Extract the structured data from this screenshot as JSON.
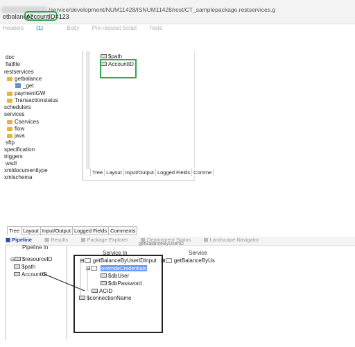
{
  "url_bar": {
    "path": "/service/development/NUM11428/ISNUM11428/rest/CT_samplepackage.restservices.g",
    "request_prefix": "etbalance?",
    "query_param": "AccountID=123"
  },
  "request_tabs": [
    {
      "label": "Headers",
      "count": "(1)"
    },
    {
      "label": "Body"
    },
    {
      "label": "Pre-request Script"
    },
    {
      "label": "Tests"
    }
  ],
  "navigator": {
    "items": [
      {
        "label": "doc",
        "icon": "none"
      },
      {
        "label": "flatfile",
        "icon": "none"
      },
      {
        "label": "restservices",
        "icon": "none"
      },
      {
        "label": "getbalance",
        "icon": "folder-icon"
      },
      {
        "label": "_get",
        "icon": "service-icon"
      },
      {
        "label": "paymentGW",
        "icon": "folder-icon"
      },
      {
        "label": "Transactionstatus",
        "icon": "folder-icon"
      },
      {
        "label": "schedulers",
        "icon": "none"
      },
      {
        "label": "services",
        "icon": "none"
      },
      {
        "label": "Cservices",
        "icon": "folder-icon"
      },
      {
        "label": "flow",
        "icon": "folder-icon"
      },
      {
        "label": "java",
        "icon": "folder-icon"
      },
      {
        "label": "sftp",
        "icon": "none"
      },
      {
        "label": "specification",
        "icon": "none"
      },
      {
        "label": "triggers",
        "icon": "none"
      },
      {
        "label": "wsdl",
        "icon": "none"
      },
      {
        "label": "xmldocumenttype",
        "icon": "none"
      },
      {
        "label": "xmlschema",
        "icon": "none"
      }
    ]
  },
  "upper_pipeline": {
    "vars": [
      "$path",
      "AccountID"
    ],
    "tabs": [
      "Tree",
      "Layout",
      "Input/Output",
      "Logged Fields",
      "Comme"
    ]
  },
  "lower_window": {
    "tabs": [
      "Tree",
      "Layout",
      "Input/Output",
      "Logged Fields",
      "Comments"
    ],
    "toolbar": [
      "Pipeline",
      "Results",
      "Package Explorer",
      "Deployment Status",
      "Landscape Navigator"
    ],
    "pipeline_in_header": "Pipeline In",
    "service_in_header": "Service In",
    "service_header": "Service",
    "service_name_partial": "getBalanceByUserID",
    "pipeline_in_vars": [
      "$resourceID",
      "$path",
      "AccountID"
    ],
    "service_in_tree": {
      "root": "getBalanceByUserIDInput",
      "override": "overrideCredentials",
      "db_user": "$dbUser",
      "db_password": "$dbPassword",
      "acid": "ACID",
      "connection": "$connectionName"
    },
    "right_partial": "getBalanceByUs"
  },
  "colors": {
    "highlight_green": "#2ea84a",
    "selection_blue": "#6a9cf0"
  }
}
